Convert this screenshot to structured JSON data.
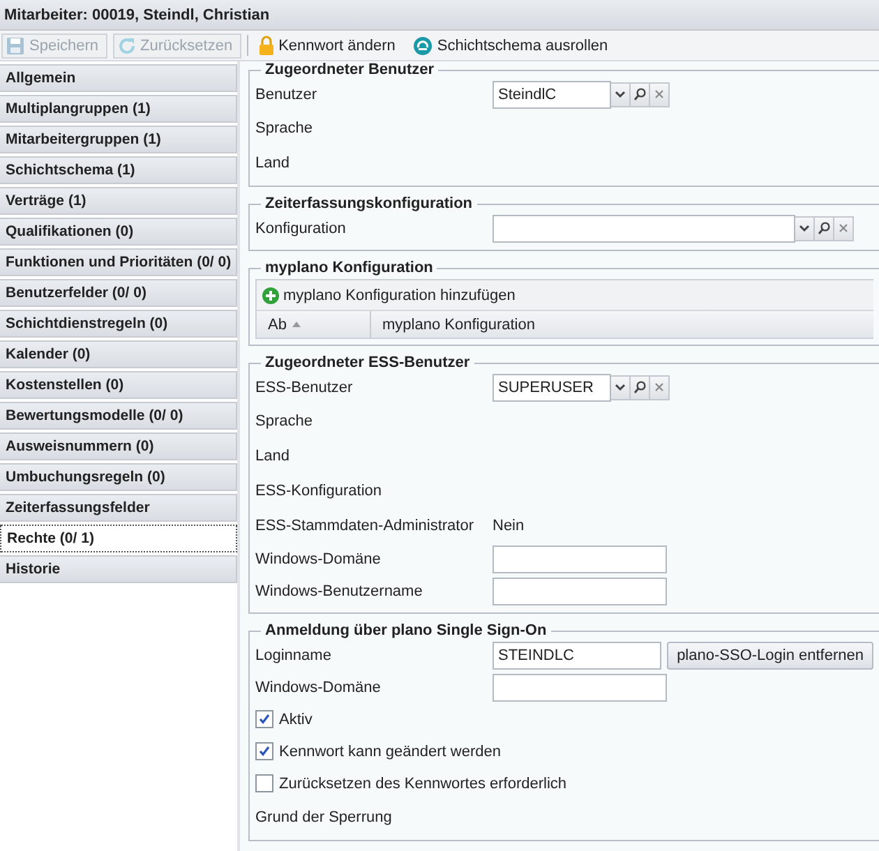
{
  "window": {
    "title": "Mitarbeiter: 00019, Steindl, Christian"
  },
  "toolbar": [
    {
      "kind": "save",
      "label": "Speichern",
      "disabled": true
    },
    {
      "kind": "reset",
      "label": "Zurücksetzen",
      "disabled": true
    },
    {
      "kind": "lock",
      "label": "Kennwort ändern",
      "disabled": false
    },
    {
      "kind": "roll",
      "label": "Schichtschema ausrollen",
      "disabled": false
    }
  ],
  "sidebar": {
    "items": [
      {
        "label": "Allgemein",
        "selected": false
      },
      {
        "label": "Multiplangruppen (1)",
        "selected": false
      },
      {
        "label": "Mitarbeitergruppen (1)",
        "selected": false
      },
      {
        "label": "Schichtschema (1)",
        "selected": false
      },
      {
        "label": "Verträge (1)",
        "selected": false
      },
      {
        "label": "Qualifikationen (0)",
        "selected": false
      },
      {
        "label": "Funktionen und Prioritäten (0/ 0)",
        "selected": false
      },
      {
        "label": "Benutzerfelder (0/ 0)",
        "selected": false
      },
      {
        "label": "Schichtdienstregeln (0)",
        "selected": false
      },
      {
        "label": "Kalender (0)",
        "selected": false
      },
      {
        "label": "Kostenstellen (0)",
        "selected": false
      },
      {
        "label": "Bewertungsmodelle (0/ 0)",
        "selected": false
      },
      {
        "label": "Ausweisnummern (0)",
        "selected": false
      },
      {
        "label": "Umbuchungsregeln (0)",
        "selected": false
      },
      {
        "label": "Zeiterfassungsfelder",
        "selected": false
      },
      {
        "label": "Rechte (0/ 1)",
        "selected": true
      },
      {
        "label": "Historie",
        "selected": false
      }
    ]
  },
  "sections": [
    {
      "title": "Zugeordneter Benutzer",
      "rows": [
        {
          "kind": "combo",
          "label": "Benutzer",
          "value": "SteindlC"
        },
        {
          "kind": "plain",
          "label": "Sprache"
        },
        {
          "kind": "plain",
          "label": "Land"
        }
      ]
    },
    {
      "title": "Zeiterfassungskonfiguration",
      "rows": [
        {
          "kind": "combo_wide",
          "label": "Konfiguration"
        }
      ]
    },
    {
      "title": "myplano Konfiguration",
      "rows": [
        {
          "kind": "grid",
          "add_label": "myplano Konfiguration hinzufügen",
          "columns": [
            {
              "label": "Ab",
              "sorted": true
            },
            {
              "label": "myplano Konfiguration",
              "sorted": false
            }
          ]
        }
      ]
    },
    {
      "title": "Zugeordneter ESS-Benutzer",
      "rows": [
        {
          "kind": "combo",
          "label": "ESS-Benutzer",
          "value": "SUPERUSER"
        },
        {
          "kind": "plain",
          "label": "Sprache"
        },
        {
          "kind": "plain",
          "label": "Land"
        },
        {
          "kind": "plain",
          "label": "ESS-Konfiguration"
        },
        {
          "kind": "value",
          "label": "ESS-Stammdaten-Administrator",
          "value": "Nein"
        },
        {
          "kind": "input",
          "label": "Windows-Domäne"
        },
        {
          "kind": "input",
          "label": "Windows-Benutzername"
        }
      ]
    },
    {
      "title": "Anmeldung über plano Single Sign-On",
      "rows": [
        {
          "kind": "input",
          "label": "Loginname",
          "value": "STEINDLC",
          "button": "plano-SSO-Login entfernen"
        },
        {
          "kind": "input",
          "label": "Windows-Domäne"
        },
        {
          "kind": "checkbox",
          "label": "Aktiv",
          "checked": true
        },
        {
          "kind": "checkbox",
          "label": "Kennwort kann geändert werden",
          "checked": true
        },
        {
          "kind": "checkbox",
          "label": "Zurücksetzen des Kennwortes erforderlich",
          "checked": false
        },
        {
          "kind": "plain",
          "label": "Grund der Sperrung"
        }
      ]
    }
  ]
}
